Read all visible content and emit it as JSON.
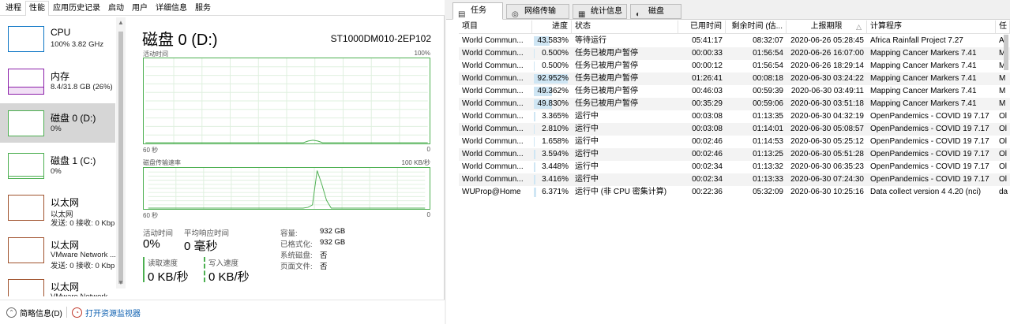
{
  "taskmgr": {
    "tabs": [
      "进程",
      "性能",
      "应用历史记录",
      "启动",
      "用户",
      "详细信息",
      "服务"
    ],
    "active_tab": 1,
    "sidebar": [
      {
        "title": "CPU",
        "sub": "100%  3.82 GHz",
        "sub2": "",
        "color": "#0c75c5"
      },
      {
        "title": "内存",
        "sub": "8.4/31.8 GB (26%)",
        "sub2": "",
        "color": "#8b1fa9"
      },
      {
        "title": "磁盘 0 (D:)",
        "sub": "0%",
        "sub2": "",
        "color": "#4caf50",
        "selected": true
      },
      {
        "title": "磁盘 1 (C:)",
        "sub": "0%",
        "sub2": "",
        "color": "#4caf50"
      },
      {
        "title": "以太网",
        "sub": "以太网",
        "sub2": "发送: 0 接收: 0 Kbp",
        "color": "#a0522d"
      },
      {
        "title": "以太网",
        "sub": "VMware Network ...",
        "sub2": "发送: 0 接收: 0 Kbp",
        "color": "#a0522d"
      },
      {
        "title": "以太网",
        "sub": "VMware Network ...",
        "sub2": "发送: 0 接收: 0 Kbp",
        "color": "#a0522d"
      }
    ],
    "disk": {
      "title": "磁盘 0 (D:)",
      "model": "ST1000DM010-2EP102",
      "graph1_label": "活动时间",
      "graph1_max": "100%",
      "graph1_time": "60 秒",
      "graph1_min": "0",
      "graph2_label": "磁盘传输速率",
      "graph2_max": "100 KB/秒",
      "graph2_time": "60 秒",
      "graph2_min": "0",
      "active_time_label": "活动时间",
      "active_time_value": "0%",
      "avg_resp_label": "平均响应时间",
      "avg_resp_value": "0 毫秒",
      "read_label": "读取速度",
      "read_value": "0 KB/秒",
      "write_label": "写入速度",
      "write_value": "0 KB/秒",
      "props": [
        {
          "k": "容量:",
          "v": "932 GB"
        },
        {
          "k": "已格式化:",
          "v": "932 GB"
        },
        {
          "k": "系统磁盘:",
          "v": "否"
        },
        {
          "k": "页面文件:",
          "v": "否"
        }
      ],
      "accent": "#4caf50",
      "activity_series": [
        0,
        0,
        0,
        0,
        0,
        0,
        0,
        0,
        0,
        0,
        0,
        0,
        0,
        0,
        0,
        0,
        0,
        0,
        0,
        0,
        0,
        0,
        0,
        0,
        0,
        0,
        0,
        0,
        0,
        0,
        0,
        0,
        0,
        0,
        2,
        3,
        2,
        0,
        0,
        0,
        0,
        0,
        0,
        0,
        0,
        0,
        0,
        0,
        0,
        0,
        0,
        0,
        0,
        0,
        0,
        0,
        0,
        0,
        0,
        0
      ],
      "rate_series": [
        0,
        0,
        0,
        0,
        0,
        0,
        0,
        0,
        0,
        0,
        0,
        0,
        0,
        0,
        0,
        0,
        0,
        0,
        0,
        0,
        0,
        0,
        0,
        0,
        0,
        0,
        0,
        0,
        0,
        0,
        0,
        0,
        0,
        0,
        2,
        8,
        95,
        60,
        20,
        0,
        0,
        0,
        0,
        0,
        0,
        0,
        0,
        0,
        0,
        0,
        0,
        0,
        0,
        0,
        0,
        0,
        0,
        0,
        0,
        0
      ]
    },
    "footer": {
      "summary": "简略信息(D)",
      "monitor": "打开资源监视器"
    }
  },
  "boinc": {
    "tabs": [
      {
        "icon": "▤",
        "label": "任务",
        "active": true
      },
      {
        "icon": "◎",
        "label": "网络传输"
      },
      {
        "icon": "▦",
        "label": "统计信息"
      },
      {
        "icon": "◐",
        "label": "磁盘"
      }
    ],
    "columns": [
      "项目",
      "进度",
      "状态",
      "已用时间",
      "剩余时间 (估...",
      "上报期限",
      "计算程序",
      "任"
    ],
    "sort_indicator": "△",
    "rows": [
      {
        "project": "World Commun...",
        "progress": "43.583%",
        "pct": 43.583,
        "status": "等待运行",
        "elapsed": "05:41:17",
        "remaining": "08:32:07",
        "deadline": "2020-06-26 05:28:45",
        "app": "Africa Rainfall Project 7.27",
        "extra": "Af"
      },
      {
        "project": "World Commun...",
        "progress": "0.500%",
        "pct": 0.5,
        "status": "任务已被用户暂停",
        "elapsed": "00:00:33",
        "remaining": "01:56:54",
        "deadline": "2020-06-26 16:07:00",
        "app": "Mapping Cancer Markers 7.41",
        "extra": "M"
      },
      {
        "project": "World Commun...",
        "progress": "0.500%",
        "pct": 0.5,
        "status": "任务已被用户暂停",
        "elapsed": "00:00:12",
        "remaining": "01:56:54",
        "deadline": "2020-06-26 18:29:14",
        "app": "Mapping Cancer Markers 7.41",
        "extra": "M"
      },
      {
        "project": "World Commun...",
        "progress": "92.952%",
        "pct": 92.952,
        "status": "任务已被用户暂停",
        "elapsed": "01:26:41",
        "remaining": "00:08:18",
        "deadline": "2020-06-30 03:24:22",
        "app": "Mapping Cancer Markers 7.41",
        "extra": "M"
      },
      {
        "project": "World Commun...",
        "progress": "49.362%",
        "pct": 49.362,
        "status": "任务已被用户暂停",
        "elapsed": "00:46:03",
        "remaining": "00:59:39",
        "deadline": "2020-06-30 03:49:11",
        "app": "Mapping Cancer Markers 7.41",
        "extra": "M"
      },
      {
        "project": "World Commun...",
        "progress": "49.830%",
        "pct": 49.83,
        "status": "任务已被用户暂停",
        "elapsed": "00:35:29",
        "remaining": "00:59:06",
        "deadline": "2020-06-30 03:51:18",
        "app": "Mapping Cancer Markers 7.41",
        "extra": "M"
      },
      {
        "project": "World Commun...",
        "progress": "3.365%",
        "pct": 3.365,
        "status": "运行中",
        "elapsed": "00:03:08",
        "remaining": "01:13:35",
        "deadline": "2020-06-30 04:32:19",
        "app": "OpenPandemics - COVID 19 7.17",
        "extra": "Ol"
      },
      {
        "project": "World Commun...",
        "progress": "2.810%",
        "pct": 2.81,
        "status": "运行中",
        "elapsed": "00:03:08",
        "remaining": "01:14:01",
        "deadline": "2020-06-30 05:08:57",
        "app": "OpenPandemics - COVID 19 7.17",
        "extra": "Ol"
      },
      {
        "project": "World Commun...",
        "progress": "1.658%",
        "pct": 1.658,
        "status": "运行中",
        "elapsed": "00:02:46",
        "remaining": "01:14:53",
        "deadline": "2020-06-30 05:25:12",
        "app": "OpenPandemics - COVID 19 7.17",
        "extra": "Ol"
      },
      {
        "project": "World Commun...",
        "progress": "3.594%",
        "pct": 3.594,
        "status": "运行中",
        "elapsed": "00:02:46",
        "remaining": "01:13:25",
        "deadline": "2020-06-30 05:51:28",
        "app": "OpenPandemics - COVID 19 7.17",
        "extra": "Ol"
      },
      {
        "project": "World Commun...",
        "progress": "3.448%",
        "pct": 3.448,
        "status": "运行中",
        "elapsed": "00:02:34",
        "remaining": "01:13:32",
        "deadline": "2020-06-30 06:35:23",
        "app": "OpenPandemics - COVID 19 7.17",
        "extra": "Ol"
      },
      {
        "project": "World Commun...",
        "progress": "3.416%",
        "pct": 3.416,
        "status": "运行中",
        "elapsed": "00:02:34",
        "remaining": "01:13:33",
        "deadline": "2020-06-30 07:24:30",
        "app": "OpenPandemics - COVID 19 7.17",
        "extra": "Ol"
      },
      {
        "project": "WUProp@Home",
        "progress": "6.371%",
        "pct": 6.371,
        "status": "运行中 (非 CPU 密集计算)",
        "elapsed": "00:22:36",
        "remaining": "05:32:09",
        "deadline": "2020-06-30 10:25:16",
        "app": "Data collect version 4 4.20  (nci)",
        "extra": "da"
      }
    ]
  }
}
